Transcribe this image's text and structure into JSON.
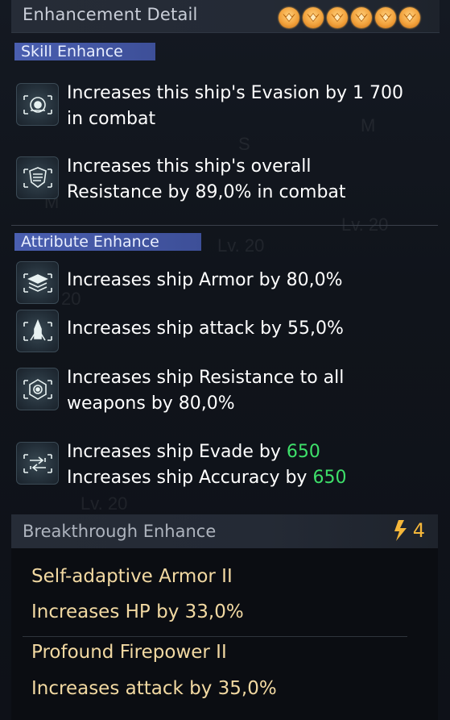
{
  "header": {
    "title": "Enhancement Detail",
    "star_count": 6
  },
  "skill_enhance": {
    "title": "Skill Enhance",
    "items": [
      {
        "icon": "evasion-eye-icon",
        "lines": [
          "Increases this ship's Evasion by 1 700",
          "in combat"
        ]
      },
      {
        "icon": "resistance-shield-icon",
        "lines": [
          "Increases this ship's overall",
          "Resistance by 89,0% in combat"
        ]
      }
    ]
  },
  "attribute_enhance": {
    "title": "Attribute Enhance",
    "items": [
      {
        "icon": "armor-layers-icon",
        "lines": [
          "Increases ship Armor by 80,0%"
        ]
      },
      {
        "icon": "attack-missile-icon",
        "lines": [
          "Increases ship attack by 55,0%"
        ]
      },
      {
        "icon": "weapon-resistance-icon",
        "lines": [
          "Increases ship Resistance to all",
          "weapons by 80,0%"
        ]
      },
      {
        "icon": "evade-accuracy-arrows-icon",
        "lines": [
          {
            "text": "Increases ship Evade by ",
            "value": "650"
          },
          {
            "text": "Increases ship Accuracy by ",
            "value": "650"
          }
        ]
      }
    ]
  },
  "breakthrough": {
    "title": "Breakthrough Enhance",
    "count": "4",
    "items": [
      {
        "name": "Self-adaptive Armor II",
        "effect": "Increases HP by 33,0%"
      },
      {
        "name": "Profound Firepower II",
        "effect": "Increases attack by 35,0%"
      }
    ]
  },
  "background_labels": [
    "M",
    "S",
    "M",
    "Lv. 20",
    "Lv. 20",
    "20",
    "Lv. 20"
  ],
  "colors": {
    "section_title_bg": "#4a5fb0",
    "highlight_value": "#3ee06a",
    "breakthrough_text": "#f2d9a2",
    "star_gold": "#f2a23c"
  }
}
